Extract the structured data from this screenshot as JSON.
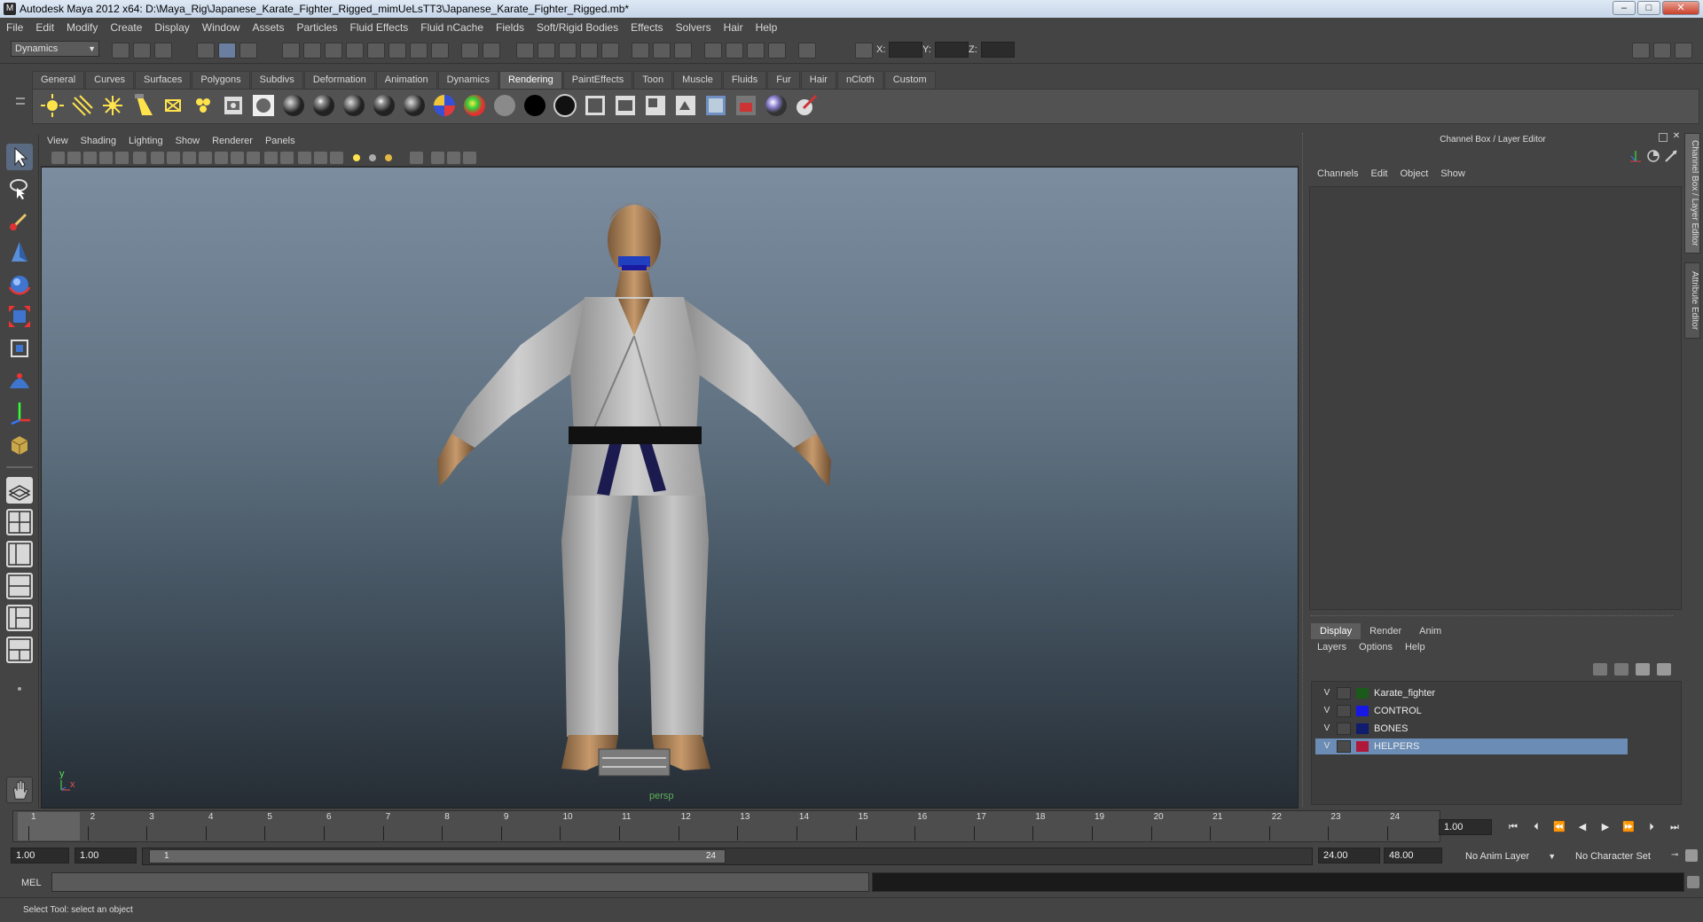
{
  "window": {
    "title": "Autodesk Maya 2012 x64: D:\\Maya_Rig\\Japanese_Karate_Fighter_Rigged_mimUeLsTT3\\Japanese_Karate_Fighter_Rigged.mb*",
    "minimize": "–",
    "maximize": "□",
    "close": "✕"
  },
  "menubar": [
    "File",
    "Edit",
    "Modify",
    "Create",
    "Display",
    "Window",
    "Assets",
    "Particles",
    "Fluid Effects",
    "Fluid nCache",
    "Fields",
    "Soft/Rigid Bodies",
    "Effects",
    "Solvers",
    "Hair",
    "Help"
  ],
  "statusline": {
    "mode": "Dynamics",
    "x_label": "X:",
    "y_label": "Y:",
    "z_label": "Z:"
  },
  "shelf": {
    "tabs": [
      "General",
      "Curves",
      "Surfaces",
      "Polygons",
      "Subdivs",
      "Deformation",
      "Animation",
      "Dynamics",
      "Rendering",
      "PaintEffects",
      "Toon",
      "Muscle",
      "Fluids",
      "Fur",
      "Hair",
      "nCloth",
      "Custom"
    ],
    "active_tab": "Rendering"
  },
  "viewport": {
    "menu": [
      "View",
      "Shading",
      "Lighting",
      "Show",
      "Renderer",
      "Panels"
    ],
    "camera_label": "persp",
    "axis_y": "y",
    "axis_x": "x"
  },
  "channel_box": {
    "title": "Channel Box / Layer Editor",
    "menu": [
      "Channels",
      "Edit",
      "Object",
      "Show"
    ],
    "side_tabs": [
      "Channel Box / Layer Editor",
      "Attribute Editor"
    ]
  },
  "layer_editor": {
    "tabs": [
      "Display",
      "Render",
      "Anim"
    ],
    "active_tab": "Display",
    "menu": [
      "Layers",
      "Options",
      "Help"
    ],
    "layers": [
      {
        "visible": "V",
        "name": "Karate_fighter",
        "color": "#1c5a1c",
        "selected": false
      },
      {
        "visible": "V",
        "name": "CONTROL",
        "color": "#1818e6",
        "selected": false
      },
      {
        "visible": "V",
        "name": "BONES",
        "color": "#101c6e",
        "selected": false
      },
      {
        "visible": "V",
        "name": "HELPERS",
        "color": "#b0183a",
        "selected": true
      }
    ]
  },
  "timeline": {
    "start_label": "1",
    "ticks": [
      "1",
      "2",
      "3",
      "4",
      "5",
      "6",
      "7",
      "8",
      "9",
      "10",
      "11",
      "12",
      "13",
      "14",
      "15",
      "16",
      "17",
      "18",
      "19",
      "20",
      "21",
      "22",
      "23",
      "24"
    ],
    "current_frame": "1.00"
  },
  "range": {
    "anim_start": "1.00",
    "playback_start": "1.00",
    "slider_start": "1",
    "slider_end": "24",
    "playback_end": "24.00",
    "anim_end": "48.00",
    "anim_layer": "No Anim Layer",
    "character_set": "No Character Set"
  },
  "command_line": {
    "label": "MEL"
  },
  "help_line": {
    "text": "Select Tool: select an object"
  }
}
